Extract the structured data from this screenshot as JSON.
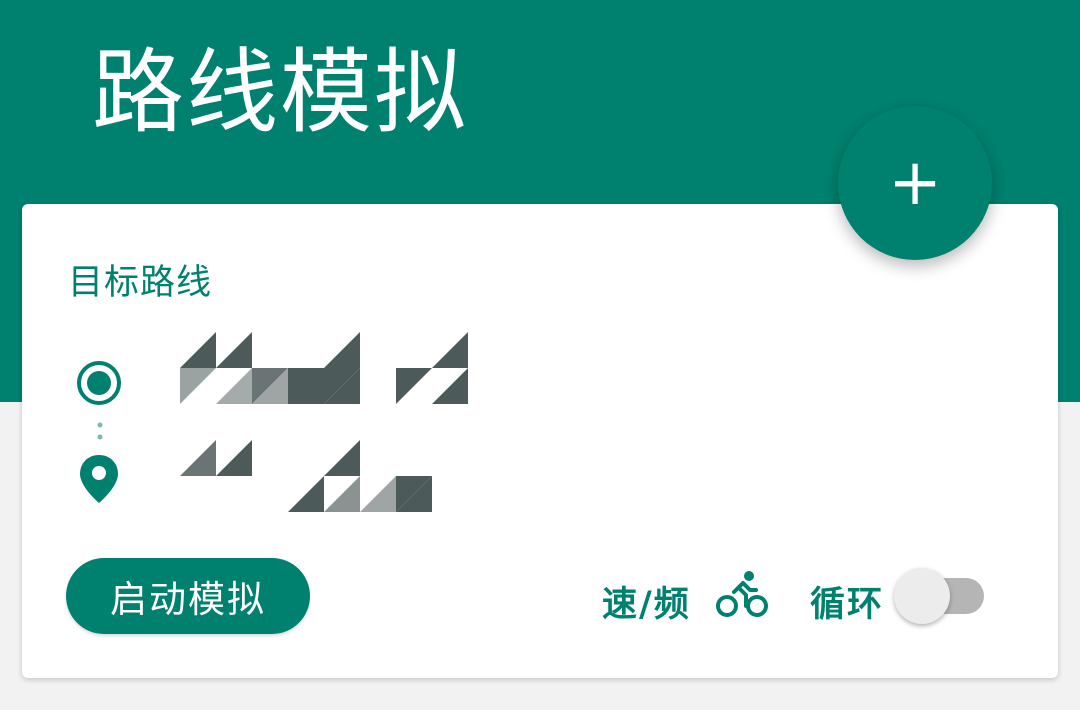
{
  "header": {
    "title": "路线模拟",
    "background_color": "#00816f"
  },
  "fab": {
    "icon": "plus-icon",
    "label": "+"
  },
  "route_card": {
    "title": "目标路线",
    "origin_icon": "origin-radio-icon",
    "destination_icon": "map-pin-icon",
    "origin_text": "",
    "destination_text": "",
    "route_text_note": "redacted"
  },
  "controls": {
    "start_button_label": "启动模拟",
    "speed_label": "速/频",
    "speed_mode_icon": "bike-icon",
    "loop_label": "循环",
    "loop_enabled": false
  },
  "colors": {
    "accent": "#00816f",
    "toggle_track_off": "#b5b5b5",
    "toggle_thumb_off": "#ececec"
  }
}
